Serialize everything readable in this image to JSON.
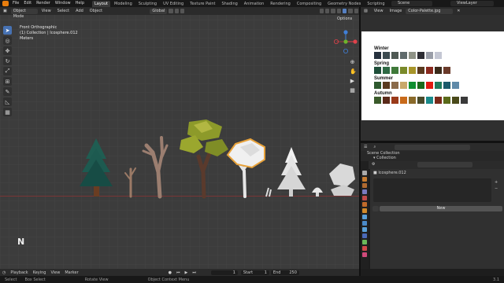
{
  "topbar": {
    "menus": [
      "File",
      "Edit",
      "Render",
      "Window",
      "Help"
    ],
    "workspaces": [
      "Layout",
      "Modeling",
      "Sculpting",
      "UV Editing",
      "Texture Paint",
      "Shading",
      "Animation",
      "Rendering",
      "Compositing",
      "Geometry Nodes",
      "Scripting"
    ],
    "active_workspace": "Layout",
    "scene": "Scene",
    "view_layer": "ViewLayer"
  },
  "viewport": {
    "mode": "Object Mode",
    "menus": [
      "View",
      "Select",
      "Add",
      "Object"
    ],
    "transform_orientation": "Global",
    "options_label": "Options",
    "view_name": "Front Orthographic",
    "collection_info": "(1) Collection | Icosphere.012",
    "units": "Meters",
    "north_label": "N",
    "gizmo": {
      "x_color": "#e0424b",
      "y_color": "#6db32c",
      "z_color": "#3f7fd8"
    }
  },
  "timeline": {
    "menus": [
      "Playback",
      "Keying",
      "View",
      "Marker"
    ],
    "current_frame": "1",
    "start_label": "Start",
    "start": "1",
    "end_label": "End",
    "end": "250"
  },
  "statusbar": {
    "hints": [
      "Select",
      "Box Select",
      "Rotate View",
      "Object Context Menu"
    ],
    "version": "3.1"
  },
  "image_editor": {
    "menus": [
      "View",
      "Image"
    ],
    "image_name": "Color-Palette.jpg",
    "palette": [
      {
        "name": "Winter",
        "colors": [
          "#27323f",
          "#3b4a4f",
          "#4f5953",
          "#5f6a6b",
          "#8f9387",
          "#2d2d33",
          "#9a9ea8",
          "#c4c7d3"
        ]
      },
      {
        "name": "Spring",
        "colors": [
          "#1f4f3a",
          "#2f6a45",
          "#3f7a3a",
          "#7a8a2a",
          "#a8952a",
          "#5a3a1f",
          "#8a2a1f",
          "#3a2a1a",
          "#6a3a2a"
        ]
      },
      {
        "name": "Summer",
        "colors": [
          "#2f5a2f",
          "#5a3a1f",
          "#8a6a4a",
          "#c8a86a",
          "#0e8f2f",
          "#1a6a1a",
          "#e01a10",
          "#1f7a5a",
          "#1a5a6a",
          "#5f8aa8"
        ]
      },
      {
        "name": "Autumn",
        "colors": [
          "#3a5a2a",
          "#5a2a1a",
          "#9a3a1a",
          "#c86a1a",
          "#8a6a2a",
          "#4a4a2a",
          "#1a8a8a",
          "#7a2a1a",
          "#5a6a1a",
          "#4a4a1a",
          "#3a3a3a"
        ]
      }
    ]
  },
  "outliner": {
    "items": [
      "Scene Collection",
      "Collection"
    ]
  },
  "properties": {
    "object_name": "Icosphere.012",
    "new_button": "New"
  }
}
